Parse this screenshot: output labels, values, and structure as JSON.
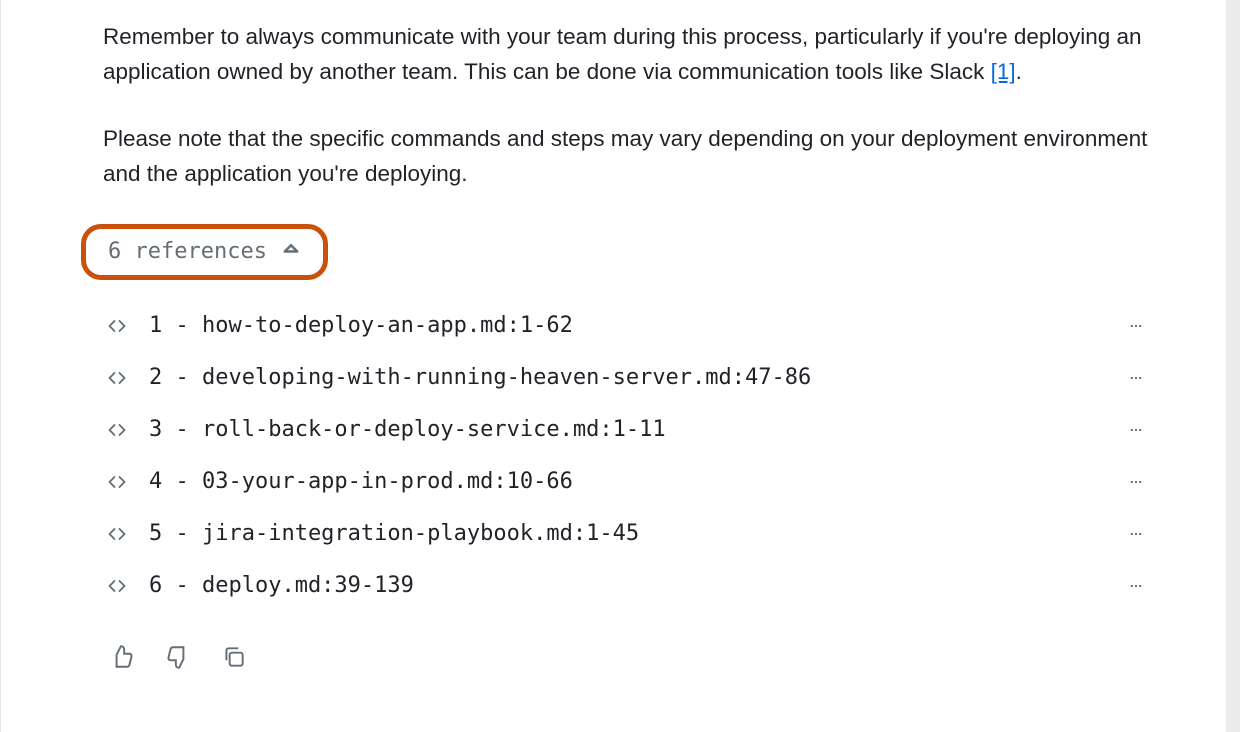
{
  "paragraphs": {
    "p1_a": "Remember to always communicate with your team during this process, particularly if you're deploying an application owned by another team. This can be done via communication tools like Slack ",
    "p1_cite": "[1]",
    "p1_b": ".",
    "p2": "Please note that the specific commands and steps may vary depending on your deployment environment and the application you're deploying."
  },
  "refs_toggle_label": "6 references",
  "references": [
    {
      "label": "1 - how-to-deploy-an-app.md:1-62"
    },
    {
      "label": "2 - developing-with-running-heaven-server.md:47-86"
    },
    {
      "label": "3 - roll-back-or-deploy-service.md:1-11"
    },
    {
      "label": "4 - 03-your-app-in-prod.md:10-66"
    },
    {
      "label": "5 - jira-integration-playbook.md:1-45"
    },
    {
      "label": "6 - deploy.md:39-139"
    }
  ]
}
